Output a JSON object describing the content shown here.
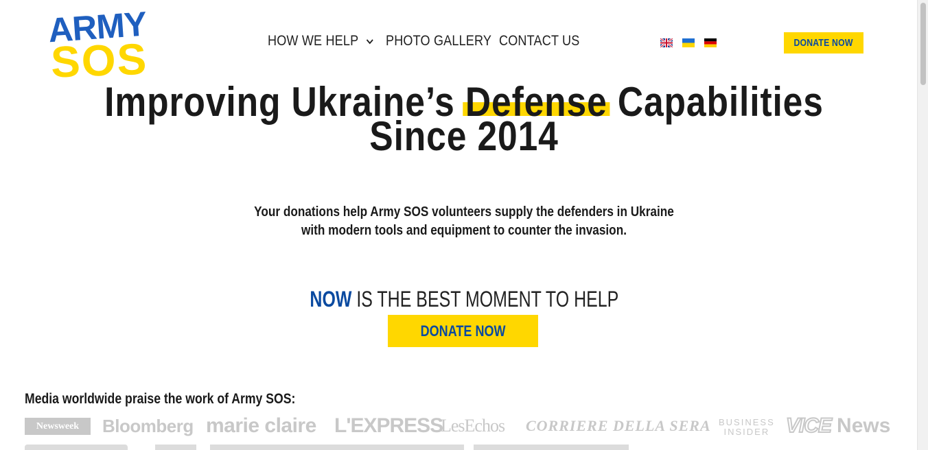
{
  "header": {
    "logo_line1": "ARMY",
    "logo_line2": "SOS",
    "nav": [
      {
        "label": "HOW WE HELP"
      },
      {
        "label": "PHOTO GALLERY"
      },
      {
        "label": "CONTACT US"
      }
    ],
    "flags": [
      "uk-flag-icon",
      "ukraine-flag-icon",
      "germany-flag-icon"
    ],
    "donate_label": "DONATE NOW"
  },
  "hero": {
    "title_part1": "Improving Ukraine’s",
    "title_highlight": "Defense",
    "title_part2": "Capabilities",
    "title_line2": "Since 2014",
    "subtitle_line1": "Your donations help Army SOS volunteers supply the defenders in Ukraine",
    "subtitle_line2": "with modern tools and equipment to counter the invasion.",
    "now_word": "NOW",
    "now_rest": "IS THE BEST MOMENT TO HELP",
    "donate_label": "DONATE NOW"
  },
  "media": {
    "title": "Media worldwide praise the work of Army SOS:",
    "logos": {
      "newsweek": "Newsweek",
      "bloomberg": "Bloomberg",
      "marie_claire": "marie claire",
      "express": "L'EXPRESS",
      "lesechos": "LesEchos",
      "corriere": "CORRIERE DELLA SERA",
      "bi_line1": "BUSINESS",
      "bi_line2": "INSIDER",
      "vice": "VICE",
      "news": "News"
    }
  },
  "colors": {
    "yellow": "#ffd700",
    "blue": "#0a4aa0",
    "logo_blue": "#1f5fbf",
    "logo_yellow": "#ffd700",
    "text": "#1a1a1a",
    "media_gray": "#c8c8c8"
  }
}
